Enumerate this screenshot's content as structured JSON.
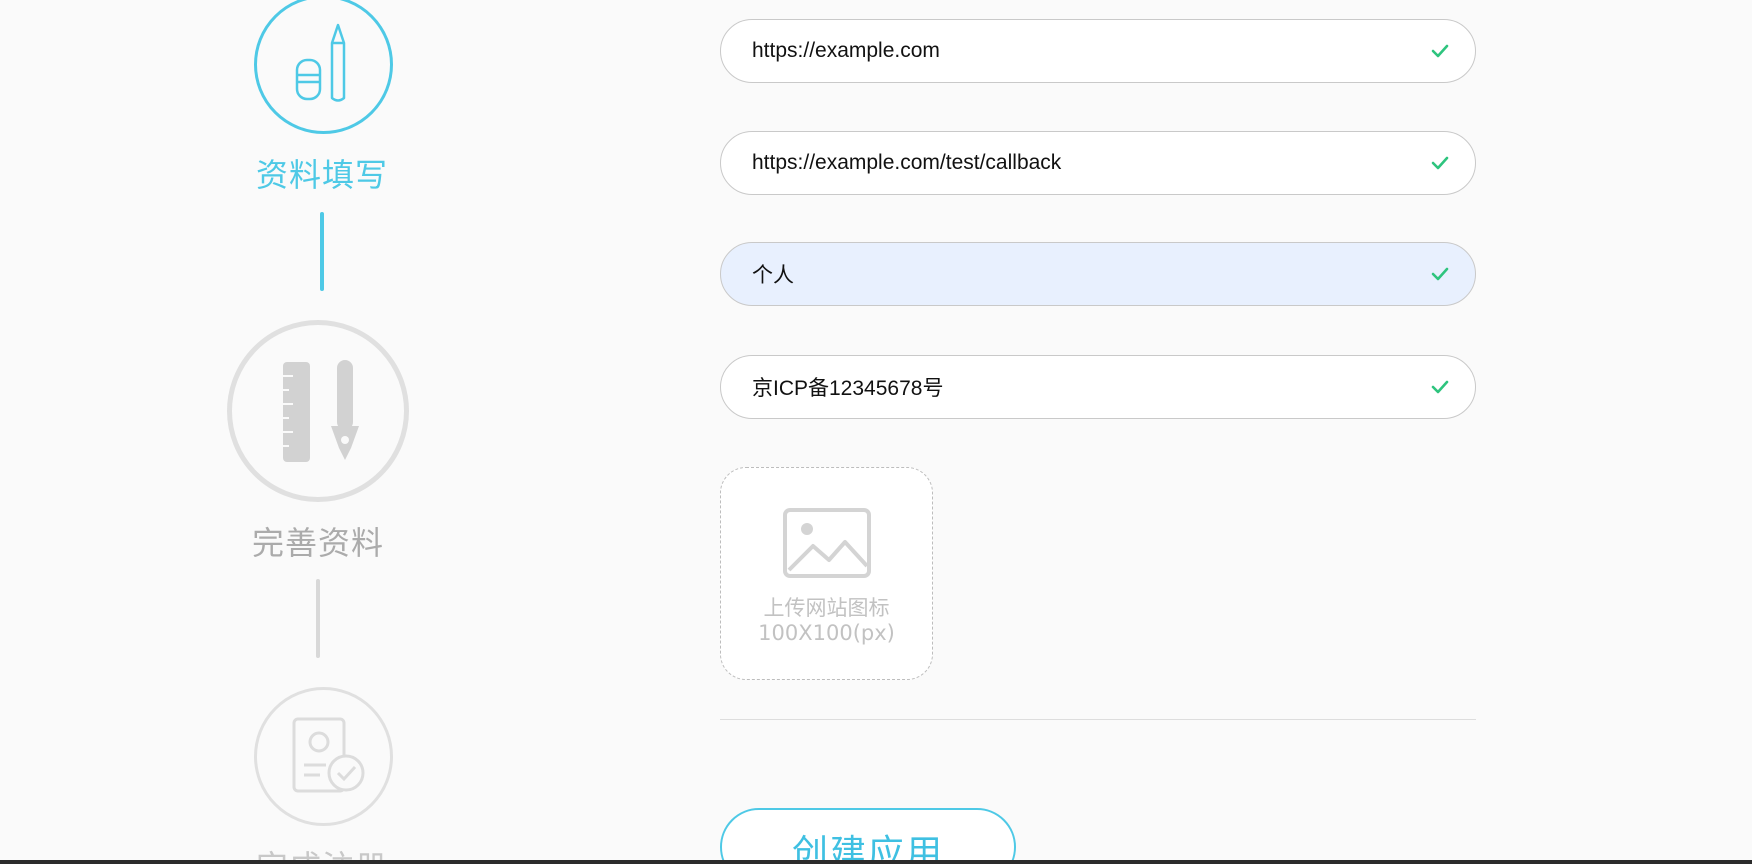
{
  "steps": [
    {
      "label": "资料填写",
      "state": "active",
      "icon": "pencil-eraser-icon"
    },
    {
      "label": "完善资料",
      "state": "inactive",
      "icon": "ruler-pen-icon"
    },
    {
      "label": "完成注册",
      "state": "inactive",
      "icon": "profile-check-icon"
    }
  ],
  "form": {
    "fields": [
      {
        "value": "https://example.com",
        "valid": true
      },
      {
        "value": "https://example.com/test/callback",
        "valid": true
      },
      {
        "value": "个人",
        "valid": true
      },
      {
        "value": "京ICP备12345678号",
        "valid": true
      }
    ],
    "upload": {
      "line1": "上传网站图标",
      "line2": "100X100(px)",
      "icon": "image-placeholder-icon"
    },
    "submit_label": "创建应用"
  },
  "colors": {
    "accent": "#4ec9e6",
    "inactive": "#dcdcdc",
    "success": "#2ec47e",
    "autofill": "#e8f0fe"
  }
}
